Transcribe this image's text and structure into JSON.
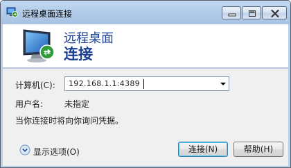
{
  "window": {
    "title": "远程桌面连接",
    "controls": {
      "minimize": "minimize",
      "maximize": "maximize",
      "close": "close"
    }
  },
  "header": {
    "line1": "远程桌面",
    "line2": "连接"
  },
  "form": {
    "computer_label": "计算机(C):",
    "computer_value": "192.168.1.1:4389",
    "username_label": "用户名:",
    "username_value": "未指定",
    "info_text": "当你连接时将向你询问凭据。"
  },
  "footer": {
    "show_options_label": "显示选项(O)",
    "connect_label": "连接(N)",
    "help_label": "帮助(H)"
  },
  "colors": {
    "title_bar": "#b1cbe9",
    "header_text": "#1b3f8f",
    "body_bg": "#f0f0f0"
  }
}
